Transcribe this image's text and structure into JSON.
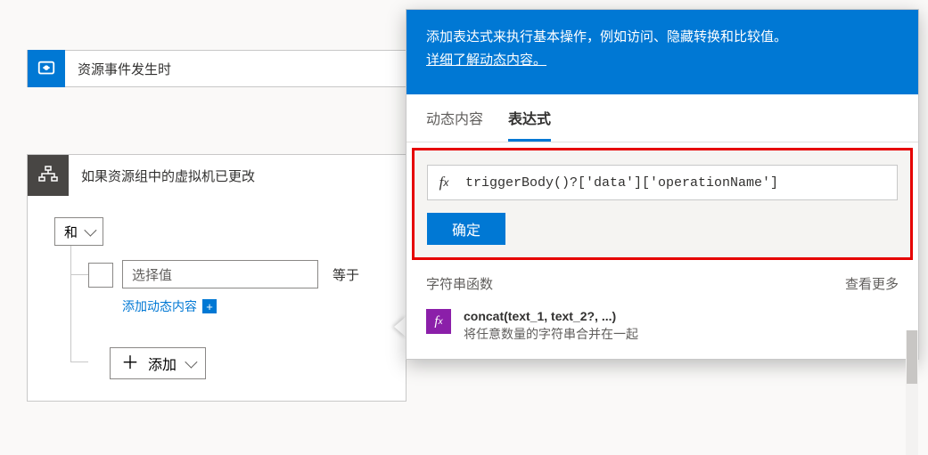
{
  "trigger": {
    "title": "资源事件发生时"
  },
  "condition": {
    "title": "如果资源组中的虚拟机已更改",
    "and_label": "和",
    "value_placeholder": "选择值",
    "dyn_link": "添加动态内容",
    "operator_label": "等于",
    "add_label": "添加"
  },
  "popup": {
    "intro": "添加表达式来执行基本操作，例如访问、隐藏转换和比较值。",
    "learn_more": "详细了解动态内容。",
    "tabs": {
      "dynamic": "动态内容",
      "expression": "表达式"
    },
    "expression_value": "triggerBody()?['data']['operationName']",
    "ok_label": "确定",
    "category": {
      "title": "字符串函数",
      "see_more": "查看更多"
    },
    "functions": [
      {
        "signature": "concat(text_1, text_2?, ...)",
        "description": "将任意数量的字符串合并在一起"
      }
    ]
  }
}
